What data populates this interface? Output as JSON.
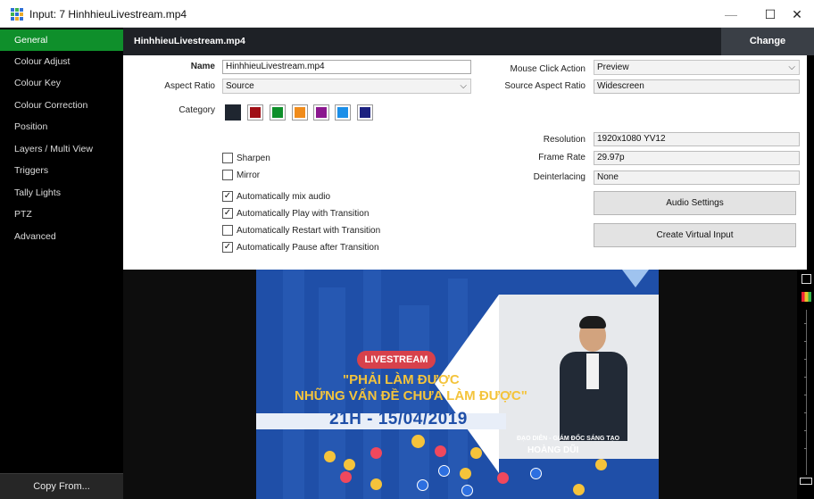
{
  "window": {
    "title": "Input: 7 HinhhieuLivestream.mp4",
    "minimize": "—",
    "maximize": "☐",
    "close": "✕"
  },
  "sidebar": {
    "items": [
      {
        "label": "General",
        "active": true
      },
      {
        "label": "Colour Adjust"
      },
      {
        "label": "Colour Key"
      },
      {
        "label": "Colour Correction"
      },
      {
        "label": "Position"
      },
      {
        "label": "Layers / Multi View"
      },
      {
        "label": "Triggers"
      },
      {
        "label": "Tally Lights"
      },
      {
        "label": "PTZ"
      },
      {
        "label": "Advanced"
      }
    ],
    "copy_from": "Copy From..."
  },
  "header": {
    "title": "HinhhieuLivestream.mp4",
    "change": "Change"
  },
  "form": {
    "name_label": "Name",
    "name_value": "HinhhieuLivestream.mp4",
    "aspect_label": "Aspect Ratio",
    "aspect_value": "Source",
    "category_label": "Category",
    "category_colors": [
      "#1f2630",
      "#a00f16",
      "#0e8f2a",
      "#f08c1c",
      "#8b178f",
      "#1a8ee8",
      "#1c2180"
    ],
    "mouse_click_label": "Mouse Click Action",
    "mouse_click_value": "Preview",
    "source_aspect_label": "Source Aspect Ratio",
    "source_aspect_value": "Widescreen",
    "resolution_label": "Resolution",
    "resolution_value": "1920x1080 YV12",
    "frame_rate_label": "Frame Rate",
    "frame_rate_value": "29.97p",
    "deinterlacing_label": "Deinterlacing",
    "deinterlacing_value": "None",
    "checkboxes": [
      {
        "label": "Sharpen",
        "checked": false
      },
      {
        "label": "Mirror",
        "checked": false
      },
      {
        "label": "Automatically mix audio",
        "checked": true
      },
      {
        "label": "Automatically Play with Transition",
        "checked": true
      },
      {
        "label": "Automatically Restart with Transition",
        "checked": false
      },
      {
        "label": "Automatically Pause after Transition",
        "checked": true
      }
    ],
    "audio_settings": "Audio Settings",
    "create_virtual_input": "Create Virtual Input",
    "check_mark": "✓"
  },
  "preview": {
    "badge": "LIVESTREAM",
    "headline_1": "\"PHẢI LÀM ĐƯỢC",
    "headline_2": "NHỮNG VẤN ĐỀ CHƯA LÀM ĐƯỢC\"",
    "date": "21H - 15/04/2019",
    "credit_role": "ĐẠO DIỄN - GIÁM ĐỐC SÁNG TẠO",
    "credit_name": "HOÀNG DŨI"
  }
}
